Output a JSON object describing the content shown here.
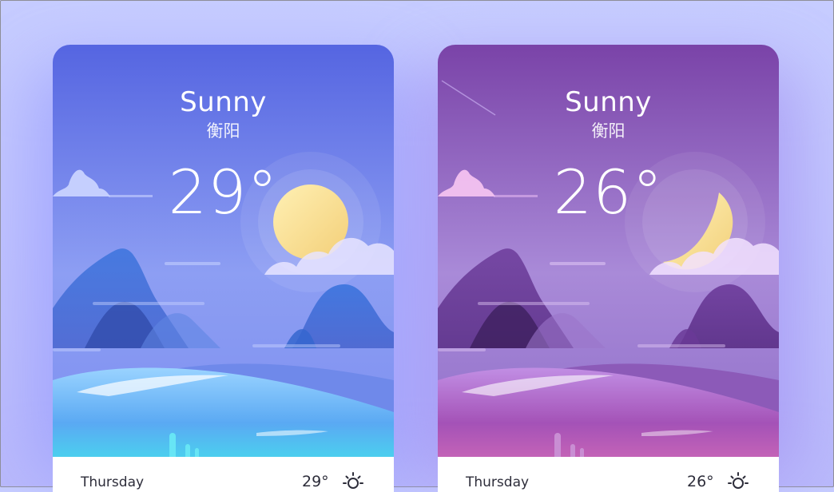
{
  "cards": [
    {
      "title": "Sunny",
      "city": "衡阳",
      "temperature": "29°",
      "day": "Thursday",
      "forecast_temp": "29°",
      "icon": "sun-icon",
      "theme_color": "#5c6fe6"
    },
    {
      "title": "Sunny",
      "city": "衡阳",
      "temperature": "26°",
      "day": "Thursday",
      "forecast_temp": "26°",
      "icon": "moon-icon",
      "theme_color": "#8a4fb7"
    }
  ]
}
